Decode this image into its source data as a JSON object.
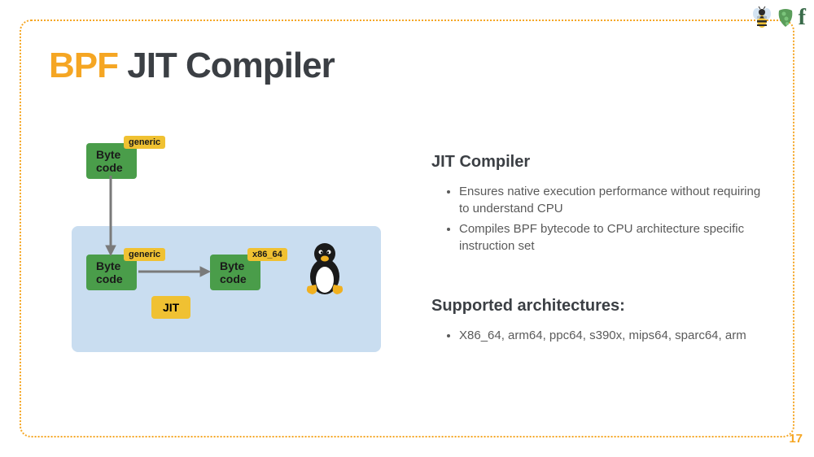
{
  "title": {
    "highlight": "BPF",
    "rest": " JIT Compiler"
  },
  "diagram": {
    "byte_label": "Byte code",
    "generic_tag": "generic",
    "x86_tag": "x86_64",
    "jit_label": "JIT"
  },
  "sections": [
    {
      "heading": "JIT Compiler",
      "items": [
        "Ensures native execution performance without requiring to understand CPU",
        "Compiles BPF bytecode to CPU architecture specific instruction set"
      ]
    },
    {
      "heading": "Supported architectures:",
      "items": [
        "X86_64, arm64, ppc64, s390x, mips64, sparc64, arm"
      ]
    }
  ],
  "page_number": "17"
}
